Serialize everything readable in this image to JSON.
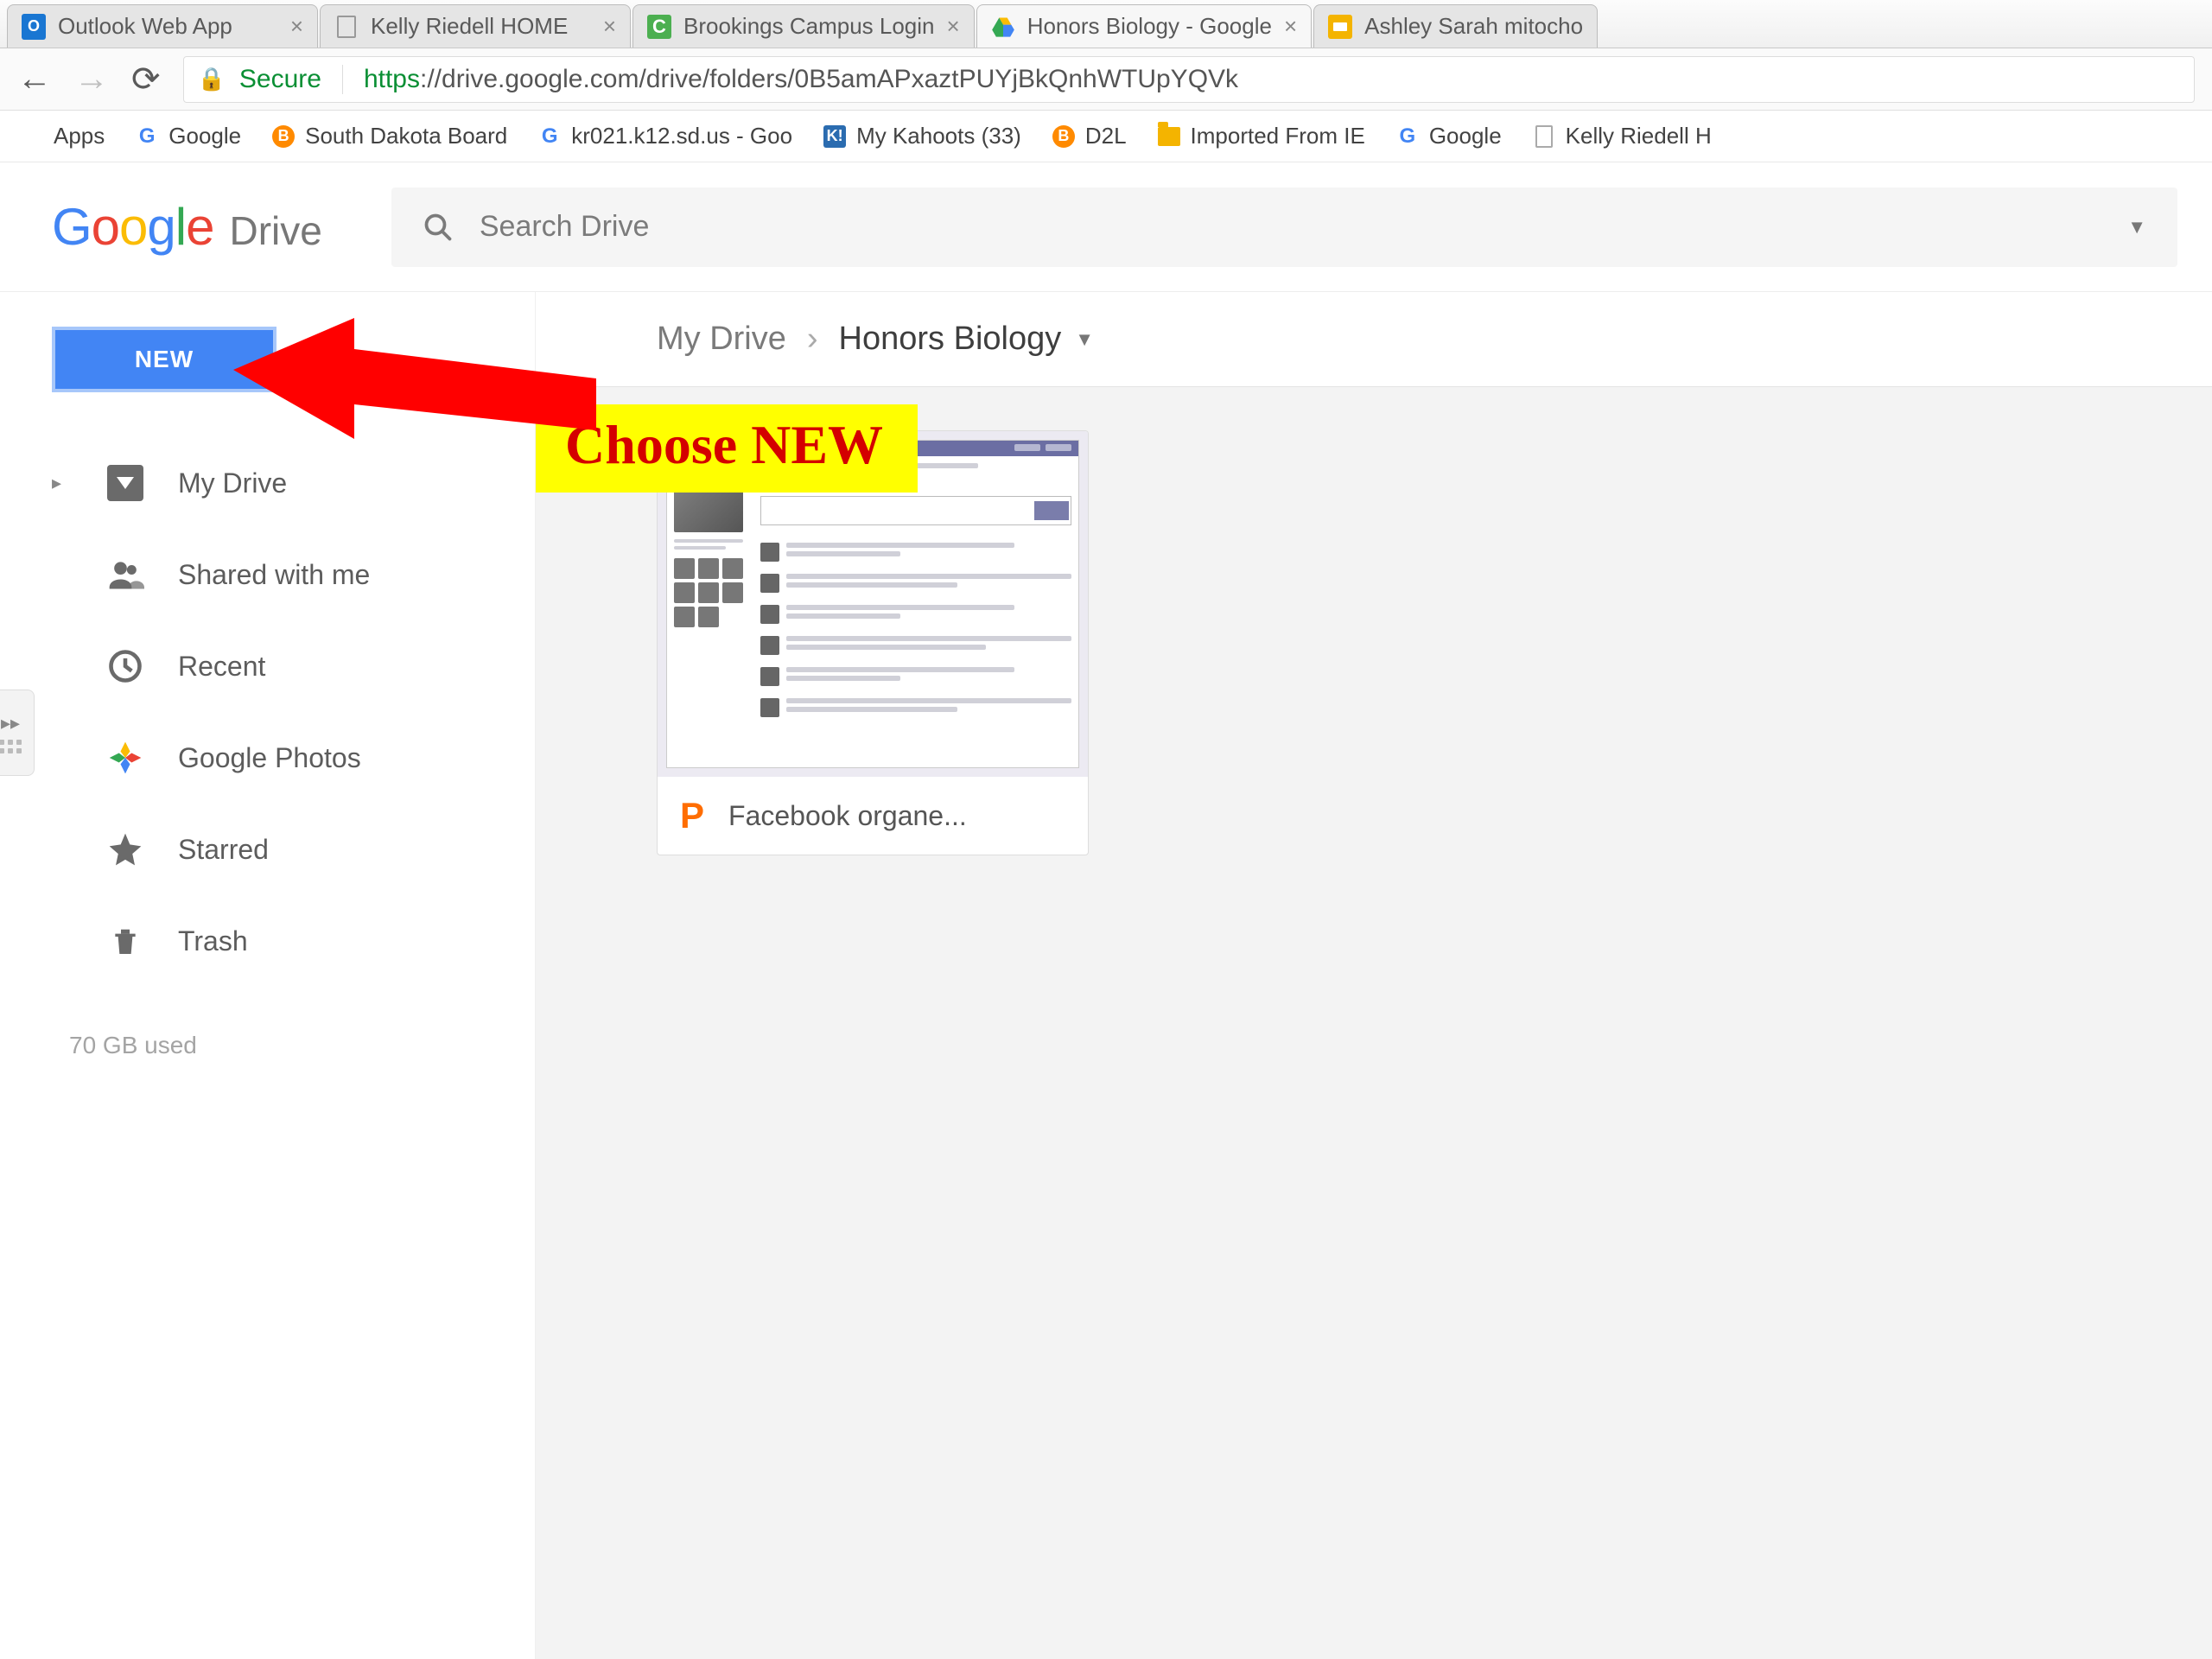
{
  "browser": {
    "tabs": [
      {
        "title": "Outlook Web App",
        "favicon": "outlook"
      },
      {
        "title": "Kelly Riedell HOME",
        "favicon": "doc"
      },
      {
        "title": "Brookings Campus Login",
        "favicon": "c"
      },
      {
        "title": "Honors Biology - Google",
        "favicon": "drive",
        "active": true
      },
      {
        "title": "Ashley Sarah mitocho",
        "favicon": "slides"
      }
    ],
    "secure_label": "Secure",
    "url_protocol": "https",
    "url_rest": "://drive.google.com/drive/folders/0B5amAPxaztPUYjBkQnhWTUpYQVk",
    "bookmarks": [
      {
        "label": "Apps",
        "icon": "apps"
      },
      {
        "label": "Google",
        "icon": "g"
      },
      {
        "label": "South Dakota Board",
        "icon": "circ"
      },
      {
        "label": "kr021.k12.sd.us - Goo",
        "icon": "g"
      },
      {
        "label": "My Kahoots (33)",
        "icon": "k"
      },
      {
        "label": "D2L",
        "icon": "circ"
      },
      {
        "label": "Imported From IE",
        "icon": "folder"
      },
      {
        "label": "Google",
        "icon": "g"
      },
      {
        "label": "Kelly Riedell H",
        "icon": "doc"
      }
    ]
  },
  "drive": {
    "product_name": "Drive",
    "search_placeholder": "Search Drive",
    "new_button": "NEW",
    "nav": {
      "my_drive": "My Drive",
      "shared": "Shared with me",
      "recent": "Recent",
      "photos": "Google Photos",
      "starred": "Starred",
      "trash": "Trash"
    },
    "storage_used": "70 GB used",
    "breadcrumb": {
      "root": "My Drive",
      "current": "Honors Biology"
    },
    "file": {
      "name": "Facebook organe...",
      "type_icon": "P"
    }
  },
  "annotation": {
    "text": "Choose NEW"
  }
}
